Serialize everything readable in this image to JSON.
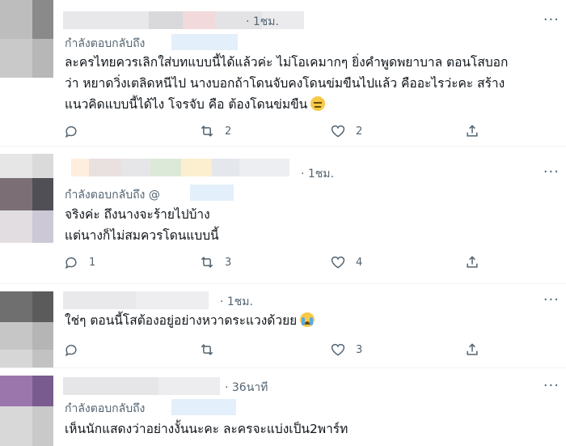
{
  "tweets": [
    {
      "time": "· 1ชม.",
      "replying_to": "กำลังตอบกลับถึง",
      "lines": [
        "ละครไทยควรเลิกใส่บทแบบนี้ได้แล้วค่ะ ไม่โอเคมากๆ ยิ่งคำพูดพยาบาล ตอนโสบอก",
        "ว่า หยาดวิ่งเตลิดหนีไป นางบอกถ้าโดนจับคงโดนข่มขืนไปแล้ว คืออะไรว่ะคะ สร้าง",
        "แนวคิดแบบนี้ได้ไง โจรจับ คือ ต้องโดนข่มขืน"
      ],
      "emoji": "expressionless-face",
      "reply_count": "",
      "retweet_count": "2",
      "like_count": "2"
    },
    {
      "time": "· 1ชม.",
      "replying_to": "กำลังตอบกลับถึง @",
      "lines": [
        "จริงค่ะ ถึงนางจะร้ายไปบ้าง",
        "แต่นางก็ไม่สมควรโดนแบบนี้"
      ],
      "reply_count": "1",
      "retweet_count": "3",
      "like_count": "4"
    },
    {
      "time": "· 1ชม.",
      "lines": [
        "ใช่ๆ ตอนนี้โสต้องอยู่อย่างหวาดระแวงด้วยย"
      ],
      "emoji": "crying-face",
      "reply_count": "",
      "retweet_count": "",
      "like_count": "3"
    },
    {
      "time": "· 36นาที",
      "replying_to": "กำลังตอบกลับถึง",
      "lines": [
        "เห็นนักแสดงว่าอย่างงั้นนะคะ ละครจะแบ่งเป็น2พาร์ท"
      ]
    }
  ],
  "more_label": "···",
  "colors": {
    "muted": "#536471",
    "text": "#0f1419",
    "accent": "#1d9bf0"
  }
}
